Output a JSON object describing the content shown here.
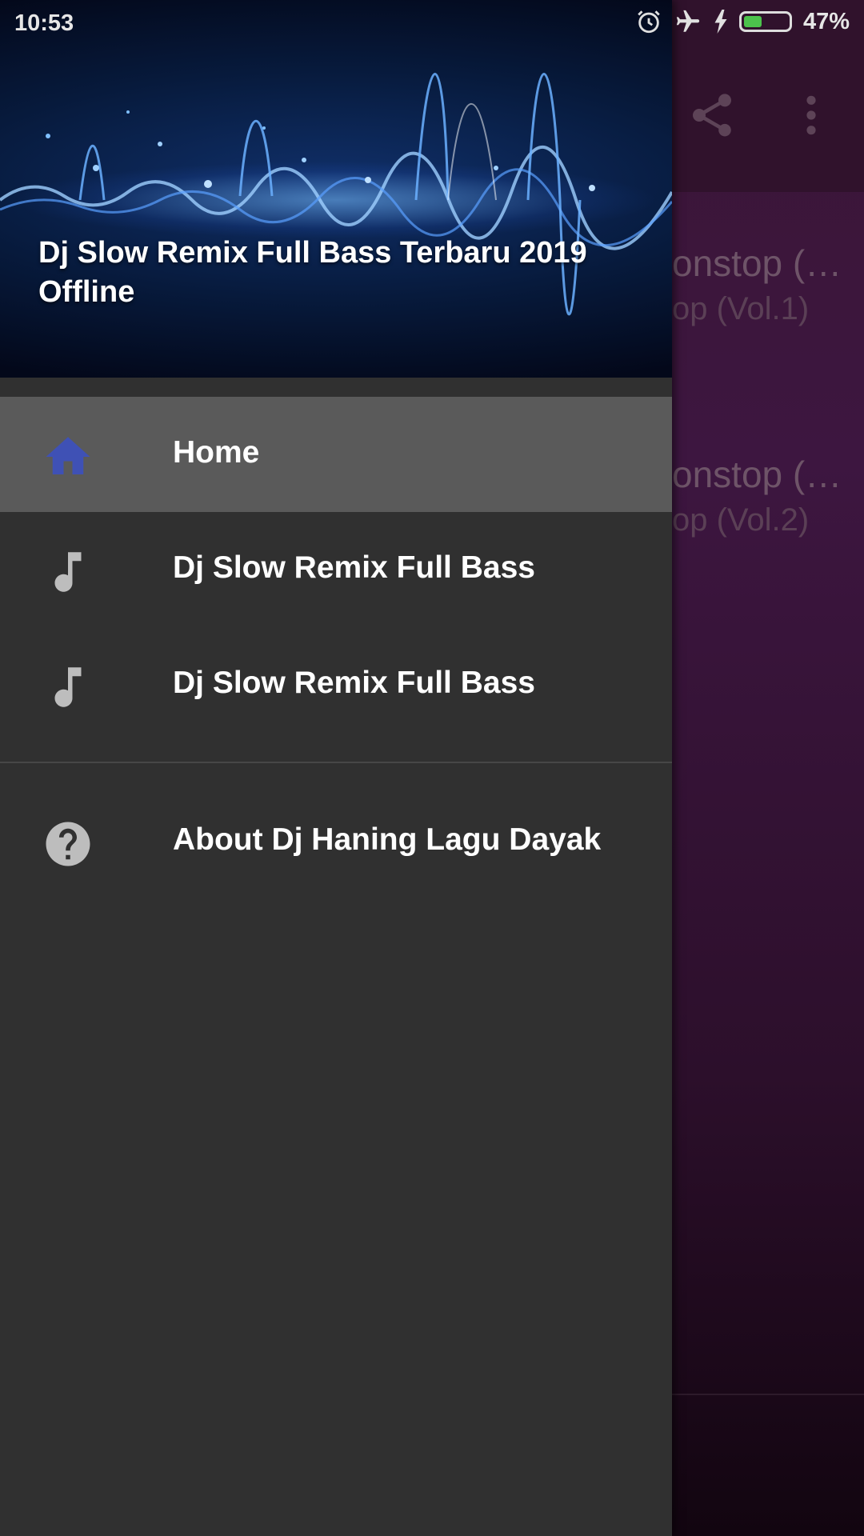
{
  "status_bar": {
    "time": "10:53",
    "battery_percent_label": "47%",
    "battery_level": 0.47,
    "icons": [
      "alarm-icon",
      "airplane-icon",
      "charging-icon",
      "battery-icon"
    ]
  },
  "background_app": {
    "toolbar_icons": [
      "share-icon",
      "more-vert-icon"
    ],
    "list": [
      {
        "title": "onstop (…",
        "subtitle": "op (Vol.1)"
      },
      {
        "title": "onstop (…",
        "subtitle": "op (Vol.2)"
      }
    ]
  },
  "drawer": {
    "header_title": "Dj Slow Remix Full Bass Terbaru 2019 Offline",
    "items": [
      {
        "label": "Home",
        "icon": "home-icon",
        "active": true
      },
      {
        "label": "Dj Slow Remix Full Bass",
        "icon": "music-note-icon",
        "active": false
      },
      {
        "label": "Dj Slow Remix Full Bass",
        "icon": "music-note-icon",
        "active": false
      },
      {
        "label": "About Dj Haning Lagu Dayak",
        "icon": "help-icon",
        "active": false
      }
    ]
  },
  "colors": {
    "drawer_bg": "#303030",
    "active_item_bg": "#5a5a5a",
    "home_icon": "#3f51b5",
    "icon_gray": "#bdbdbd",
    "background_app": "#3a1535"
  }
}
